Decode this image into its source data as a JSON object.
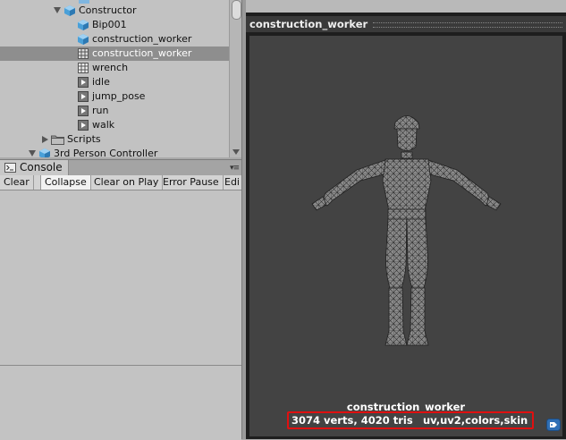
{
  "tree": {
    "items": [
      {
        "label": "Constructor",
        "icon": "prefab-cube-icon",
        "expanded": true
      },
      {
        "label": "Bip001",
        "icon": "prefab-cube-icon"
      },
      {
        "label": "construction_worker",
        "icon": "prefab-cube-icon"
      },
      {
        "label": "construction_worker",
        "icon": "mesh-grid-icon",
        "selected": true
      },
      {
        "label": "wrench",
        "icon": "mesh-grid-icon"
      },
      {
        "label": "idle",
        "icon": "animation-clip-icon"
      },
      {
        "label": "jump_pose",
        "icon": "animation-clip-icon"
      },
      {
        "label": "run",
        "icon": "animation-clip-icon"
      },
      {
        "label": "walk",
        "icon": "animation-clip-icon"
      },
      {
        "label": "Scripts",
        "icon": "folder-icon",
        "expanded": false
      },
      {
        "label": "3rd Person Controller",
        "icon": "prefab-cube-icon",
        "expanded": true
      }
    ]
  },
  "console": {
    "tab_label": "Console",
    "buttons": {
      "clear": "Clear",
      "collapse": "Collapse",
      "clear_on_play": "Clear on Play",
      "error_pause": "Error Pause",
      "editor": "Edi"
    }
  },
  "preview": {
    "title": "construction_worker",
    "model_name": "construction_worker",
    "verts_tris": "3074 verts, 4020 tris",
    "channels": "uv,uv2,colors,skin"
  },
  "colors": {
    "selection": "#8e8e8e",
    "highlight_border": "#e01010",
    "viewport_bg": "#434343",
    "prefab_blue": "#4aa0d8"
  }
}
